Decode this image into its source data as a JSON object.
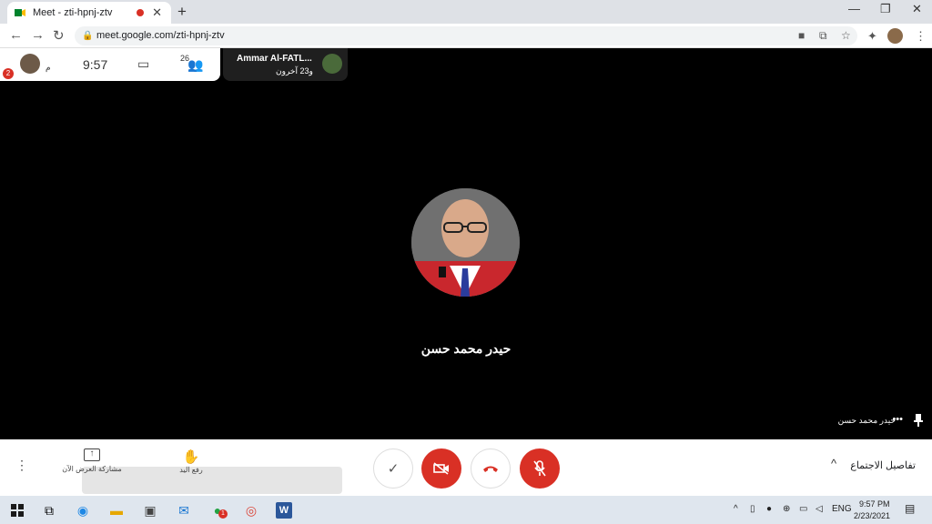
{
  "browser": {
    "tab_title": "Meet - zti-hpnj-ztv",
    "url": "meet.google.com/zti-hpnj-ztv"
  },
  "meet": {
    "notification_count": "2",
    "ampm": "م",
    "time": "9:57",
    "participant_count": "26",
    "presenter_name": "Ammar Al-FATL...",
    "presenter_others": "و23 آخرون",
    "speaker_name": "حيدر محمد حسن",
    "tile_label": "حيدر محمد حسن",
    "share_label": "مشاركة العرض الآن",
    "raise_hand_label": "رفع اليد",
    "meeting_details": "تفاصيل الاجتماع"
  },
  "colors": {
    "end_call": "#d93025",
    "accent": "#1a73e8"
  },
  "taskbar": {
    "whatsapp_badge": "1",
    "language": "ENG",
    "time": "9:57 PM",
    "date": "2/23/2021"
  }
}
